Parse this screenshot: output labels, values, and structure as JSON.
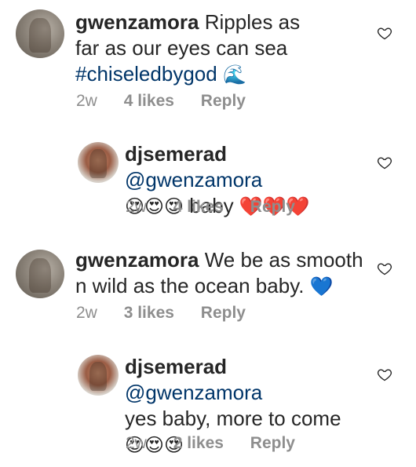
{
  "comments": [
    {
      "username": "gwenzamora",
      "text_line1": "Ripples as",
      "text_line2": "far as our eyes can sea",
      "hashtag": "#chiseledbygod",
      "emoji": "🌊",
      "time": "2w",
      "likes": "4 likes",
      "reply": "Reply"
    },
    {
      "username": "djsemerad",
      "mention": "@gwenzamora",
      "emoji_before": "😍😍😍",
      "text": "baby",
      "emoji_after": "❤️❤️❤️",
      "time": "2w",
      "likes": "4 likes",
      "reply": "Reply"
    },
    {
      "username": "gwenzamora",
      "text_line1": "We be as smooth",
      "text_line2": "n wild as the ocean baby.",
      "emoji": "💙",
      "time": "2w",
      "likes": "3 likes",
      "reply": "Reply"
    },
    {
      "username": "djsemerad",
      "mention": "@gwenzamora",
      "text_line2": "yes baby, more to come",
      "emoji": "😍😍😍",
      "time": "2w",
      "likes": "2 likes",
      "reply": "Reply"
    }
  ],
  "colors": {
    "text": "#262626",
    "meta": "#8e8e8e",
    "link": "#003569",
    "heart_outline": "#262626"
  },
  "icons": {
    "like": "heart-outline-icon"
  }
}
